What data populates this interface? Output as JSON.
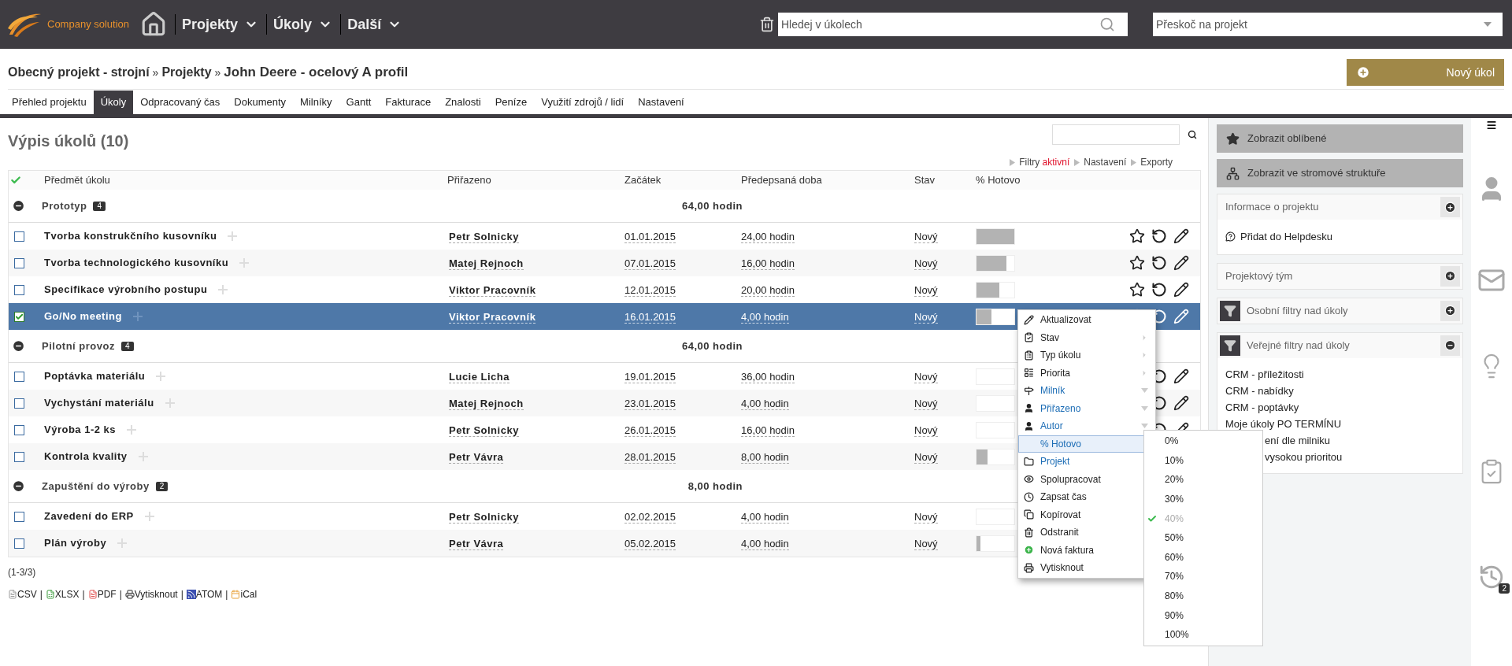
{
  "header": {
    "logo_text": "Company solution",
    "nav": [
      {
        "label": "Projekty"
      },
      {
        "label": "Úkoly"
      },
      {
        "label": "Další"
      }
    ],
    "search": {
      "placeholder": "Hledej v úkolech"
    },
    "project_select": {
      "placeholder": "Přeskoč na projekt"
    }
  },
  "breadcrumb": {
    "items": [
      "Obecný projekt - strojní",
      "Projekty"
    ],
    "separator": "»",
    "current": "John Deere - ocelový A profil"
  },
  "new_task_button": "Nový úkol",
  "tabs": [
    {
      "label": "Přehled projektu",
      "selected": false
    },
    {
      "label": "Úkoly",
      "selected": true
    },
    {
      "label": "Odpracovaný čas",
      "selected": false
    },
    {
      "label": "Dokumenty",
      "selected": false
    },
    {
      "label": "Milníky",
      "selected": false
    },
    {
      "label": "Gantt",
      "selected": false
    },
    {
      "label": "Fakturace",
      "selected": false
    },
    {
      "label": "Znalosti",
      "selected": false
    },
    {
      "label": "Peníze",
      "selected": false
    },
    {
      "label": "Využití zdrojů / lidí",
      "selected": false
    },
    {
      "label": "Nastavení",
      "selected": false
    }
  ],
  "list": {
    "title": "Výpis úkolů (10)",
    "links": [
      {
        "label": "Filtry",
        "value": "aktivní"
      },
      {
        "label": "Nastavení"
      },
      {
        "label": "Exporty"
      }
    ],
    "columns": [
      "Předmět úkolu",
      "Přiřazeno",
      "Začátek",
      "Předepsaná doba",
      "Stav",
      "% Hotovo"
    ],
    "groups": [
      {
        "name": "Prototyp",
        "count": "4",
        "total": "64,00 hodin",
        "expanded": true,
        "tasks": [
          {
            "subject": "Tvorba konstrukčního kusovníku",
            "assignee": "Petr Solnicky",
            "start": "01.01.2015",
            "duration": "24,00 hodin",
            "status": "Nový",
            "level": 1.0,
            "checked": false,
            "selected": false
          },
          {
            "subject": "Tvorba technologického kusovníku",
            "assignee": "Matej Rejnoch",
            "start": "07.01.2015",
            "duration": "16,00 hodin",
            "status": "Nový",
            "level": 0.8,
            "checked": false,
            "selected": false
          },
          {
            "subject": "Specifikace výrobního postupu",
            "assignee": "Viktor Pracovník",
            "start": "12.01.2015",
            "duration": "20,00 hodin",
            "status": "Nový",
            "level": 0.6,
            "checked": false,
            "selected": false
          },
          {
            "subject": "Go/No meeting",
            "assignee": "Viktor Pracovník",
            "start": "16.01.2015",
            "duration": "4,00 hodin",
            "status": "Nový",
            "level": 0.4,
            "checked": true,
            "selected": true
          }
        ]
      },
      {
        "name": "Pilotní provoz",
        "count": "4",
        "total": "64,00 hodin",
        "expanded": true,
        "tasks": [
          {
            "subject": "Poptávka materiálu",
            "assignee": "Lucie Licha",
            "start": "19.01.2015",
            "duration": "36,00 hodin",
            "status": "Nový",
            "level": 0,
            "checked": false,
            "selected": false
          },
          {
            "subject": "Vychystání materiálu",
            "assignee": "Matej Rejnoch",
            "start": "23.01.2015",
            "duration": "4,00 hodin",
            "status": "Nový",
            "level": 0,
            "checked": false,
            "selected": false
          },
          {
            "subject": "Výroba 1-2 ks",
            "assignee": "Petr Solnicky",
            "start": "26.01.2015",
            "duration": "16,00 hodin",
            "status": "Nový",
            "level": 0,
            "checked": false,
            "selected": false
          },
          {
            "subject": "Kontrola kvality",
            "assignee": "Petr Vávra",
            "start": "28.01.2015",
            "duration": "8,00 hodin",
            "status": "Nový",
            "level": 0.3,
            "checked": false,
            "selected": false
          }
        ]
      },
      {
        "name": "Zapuštění do výroby",
        "count": "2",
        "total": "8,00 hodin",
        "expanded": true,
        "tasks": [
          {
            "subject": "Zavedení do ERP",
            "assignee": "Petr Solnicky",
            "start": "02.02.2015",
            "duration": "4,00 hodin",
            "status": "Nový",
            "level": 0,
            "checked": false,
            "selected": false
          },
          {
            "subject": "Plán výroby",
            "assignee": "Petr Vávra",
            "start": "05.02.2015",
            "duration": "4,00 hodin",
            "status": "Nový",
            "level": 0.1,
            "checked": false,
            "selected": false
          }
        ]
      }
    ]
  },
  "paging": "(1-3/3)",
  "exports": [
    {
      "label": "CSV",
      "kind": "csv"
    },
    {
      "label": "XLSX",
      "kind": "xlsx"
    },
    {
      "label": "PDF",
      "kind": "pdf"
    },
    {
      "label": "Vytisknout",
      "kind": "print"
    },
    {
      "label": "ATOM",
      "kind": "atom"
    },
    {
      "label": "iCal",
      "kind": "ical"
    }
  ],
  "export_separator": "|",
  "context_menu": {
    "items": [
      {
        "label": "Aktualizovat",
        "kind": "action",
        "selected": false
      },
      {
        "label": "Stav",
        "kind": "submenu",
        "selected": false
      },
      {
        "label": "Typ úkolu",
        "kind": "submenu",
        "selected": false
      },
      {
        "label": "Priorita",
        "kind": "submenu",
        "selected": false
      },
      {
        "label": "Milník",
        "kind": "dropdown",
        "selected": false
      },
      {
        "label": "Přiřazeno",
        "kind": "dropdown",
        "selected": false
      },
      {
        "label": "Autor",
        "kind": "dropdown",
        "selected": false
      },
      {
        "label": "% Hotovo",
        "kind": "link",
        "selected": true
      },
      {
        "label": "Projekt",
        "kind": "link",
        "selected": false
      },
      {
        "label": "Spolupracovat",
        "kind": "action",
        "selected": false
      },
      {
        "label": "Zapsat čas",
        "kind": "action",
        "selected": false
      },
      {
        "label": "Kopírovat",
        "kind": "action",
        "selected": false
      },
      {
        "label": "Odstranit",
        "kind": "action",
        "selected": false
      },
      {
        "label": "Nová faktura",
        "kind": "action",
        "selected": false
      },
      {
        "label": "Vytisknout",
        "kind": "action",
        "selected": false
      }
    ]
  },
  "percent_menu": {
    "items": [
      {
        "label": "0%",
        "checked": false
      },
      {
        "label": "10%",
        "checked": false
      },
      {
        "label": "20%",
        "checked": false
      },
      {
        "label": "30%",
        "checked": false
      },
      {
        "label": "40%",
        "checked": true
      },
      {
        "label": "50%",
        "checked": false
      },
      {
        "label": "60%",
        "checked": false
      },
      {
        "label": "70%",
        "checked": false
      },
      {
        "label": "80%",
        "checked": false
      },
      {
        "label": "90%",
        "checked": false
      },
      {
        "label": "100%",
        "checked": false
      }
    ]
  },
  "sidebar": {
    "buttons": [
      {
        "label": "Zobrazit oblíbené",
        "kind": "favorites"
      },
      {
        "label": "Zobrazit ve stromové struktuře",
        "kind": "tree"
      }
    ],
    "panels": [
      {
        "title": "Informace o projektu",
        "kind": "plain",
        "expanded": false,
        "items": [
          {
            "label": "Přidat do Helpdesku",
            "kind": "helpdesk"
          }
        ]
      },
      {
        "title": "Projektový tým",
        "kind": "plain",
        "expanded": false
      },
      {
        "title": "Osobní filtry nad úkoly",
        "kind": "filter",
        "expanded": false
      },
      {
        "title": "Veřejné filtry nad úkoly",
        "kind": "filter",
        "expanded": true,
        "items": [
          {
            "label": "CRM - příležitosti",
            "kind": "filter"
          },
          {
            "label": "CRM - nabídky",
            "kind": "filter"
          },
          {
            "label": "CRM - poptávky",
            "kind": "filter"
          },
          {
            "label": "Moje úkoly PO TERMÍNU",
            "kind": "filter"
          }
        ],
        "covered_items": [
          "ení dle milniku",
          "vysokou prioritou"
        ]
      }
    ]
  },
  "rail": {
    "history_badge": "2"
  }
}
